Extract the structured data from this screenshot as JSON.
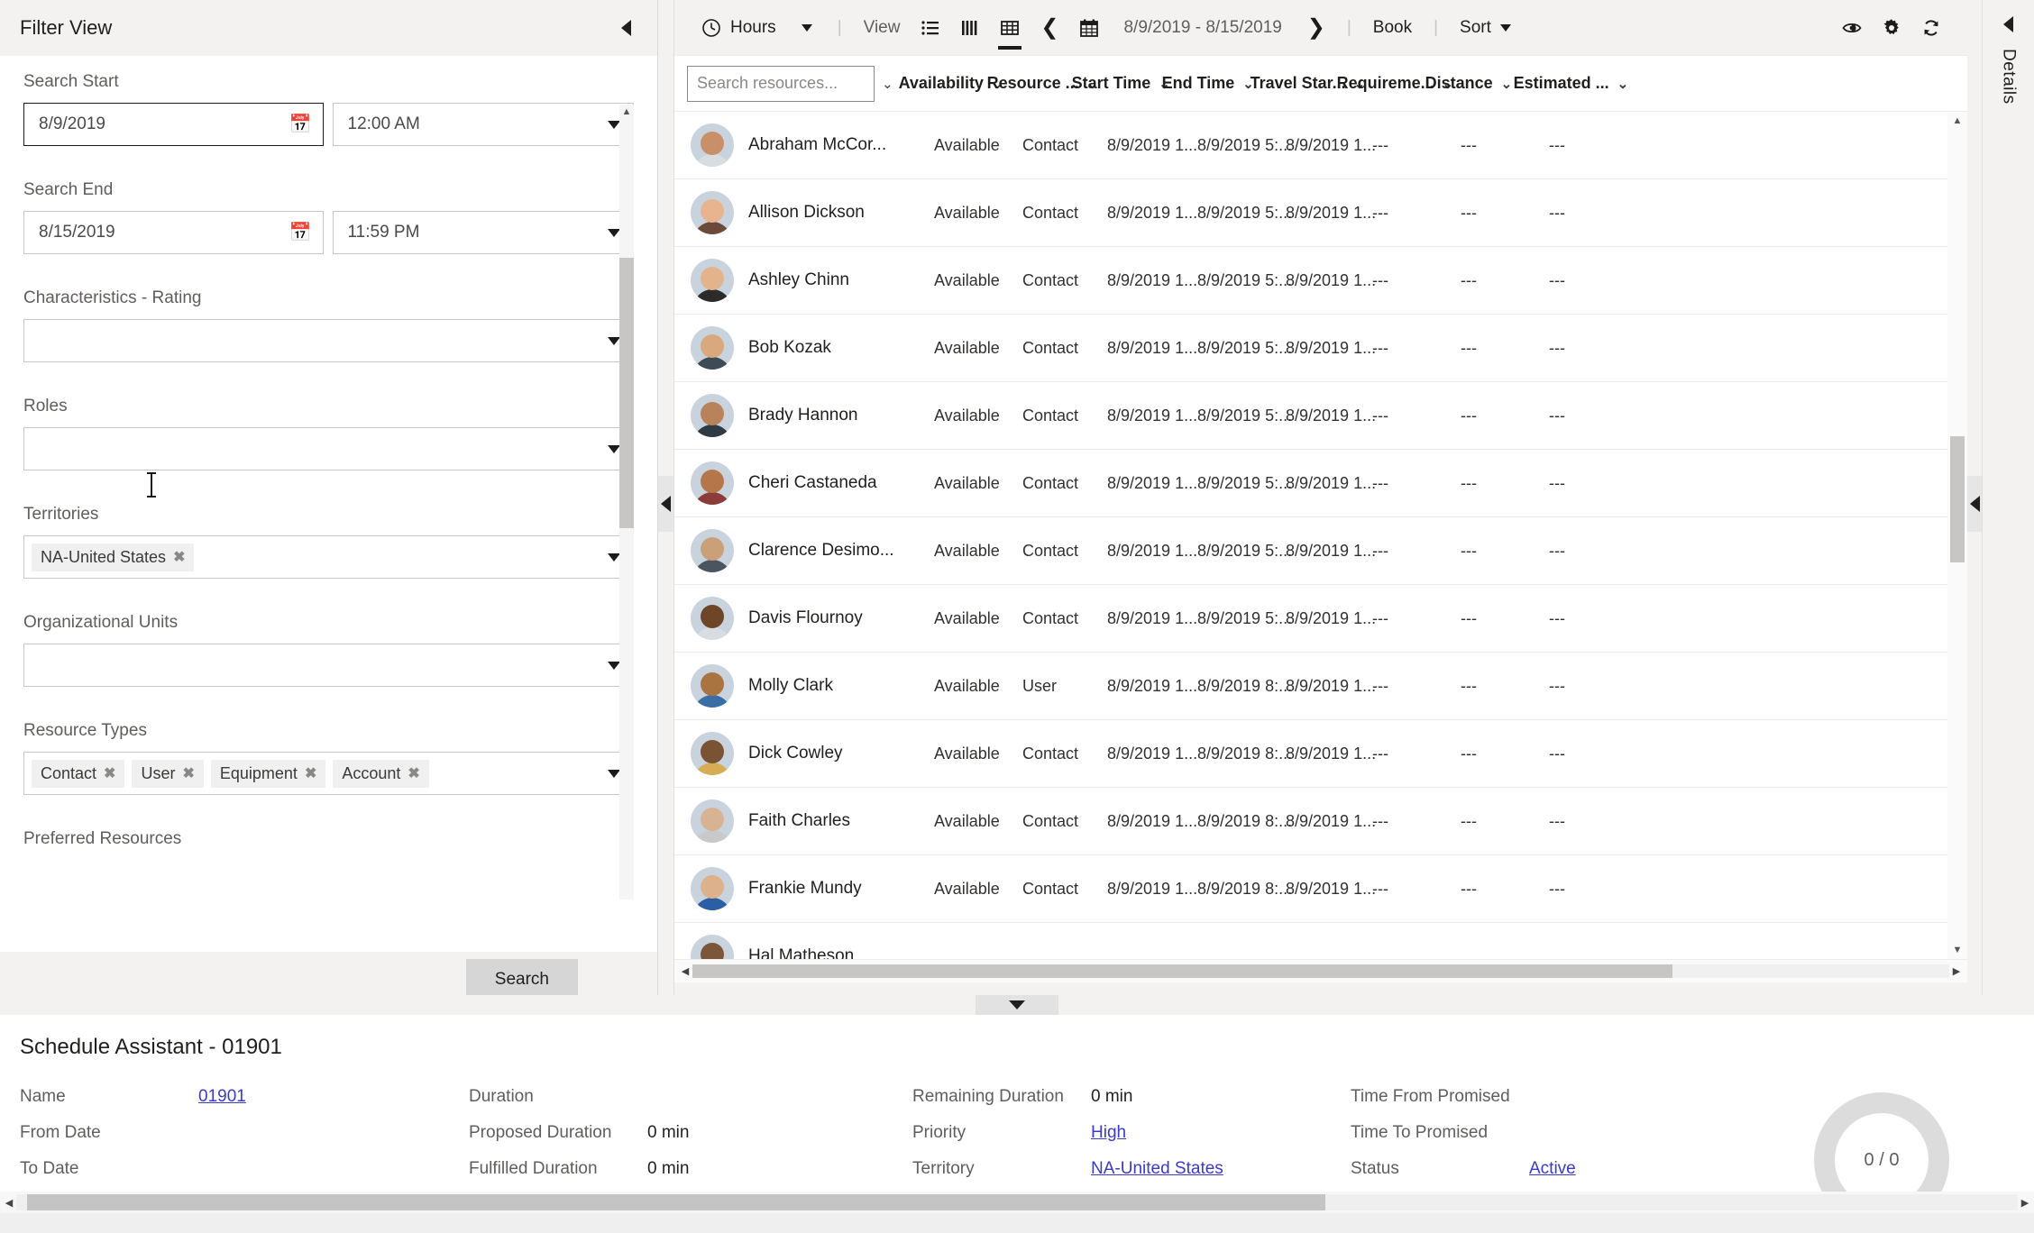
{
  "filter": {
    "title": "Filter View",
    "collapse_icon": "triangle-left-icon",
    "search_start": {
      "label": "Search Start",
      "date_value": "8/9/2019",
      "date_icon": "calendar-icon",
      "time_value": "12:00 AM"
    },
    "search_end": {
      "label": "Search End",
      "date_value": "8/15/2019",
      "date_icon": "calendar-icon",
      "time_value": "11:59 PM"
    },
    "characteristics_rating": {
      "label": "Characteristics - Rating",
      "value": ""
    },
    "roles": {
      "label": "Roles",
      "value": ""
    },
    "territories": {
      "label": "Territories",
      "chips": [
        "NA-United States"
      ]
    },
    "organizational_units": {
      "label": "Organizational Units",
      "value": ""
    },
    "resource_types": {
      "label": "Resource Types",
      "chips": [
        "Contact",
        "User",
        "Equipment",
        "Account"
      ]
    },
    "preferred_resources": {
      "label": "Preferred Resources"
    },
    "search_button": "Search"
  },
  "toolbar": {
    "hours_label": "Hours",
    "hours_icon": "clock-icon",
    "view_label": "View",
    "view_modes": [
      {
        "name": "list-view-icon",
        "selected": false
      },
      {
        "name": "column-view-icon",
        "selected": false
      },
      {
        "name": "grid-view-icon",
        "selected": true
      }
    ],
    "prev_icon": "chevron-left-icon",
    "calendar_icon": "calendar-icon",
    "date_range": "8/9/2019 - 8/15/2019",
    "next_icon": "chevron-right-icon",
    "book_label": "Book",
    "sort_label": "Sort",
    "eye_icon": "eye-icon",
    "gear_icon": "gear-icon",
    "refresh_icon": "refresh-icon"
  },
  "grid": {
    "search_placeholder": "Search resources...",
    "search_value": "",
    "columns": [
      "Availability",
      "Resource ...",
      "Start Time",
      "End Time",
      "Travel Star...",
      "Requireme...",
      "Distance",
      "Estimated ..."
    ],
    "rows": [
      {
        "name": "Abraham McCor...",
        "availability": "Available",
        "type": "Contact",
        "start": "8/9/2019 1...",
        "end": "8/9/2019 5:...",
        "travel": "8/9/2019 1...",
        "requirement": "---",
        "distance": "---",
        "estimated": "---",
        "skin": "#c98f68",
        "shirt": "#d8dde2"
      },
      {
        "name": "Allison Dickson",
        "availability": "Available",
        "type": "Contact",
        "start": "8/9/2019 1...",
        "end": "8/9/2019 5:...",
        "travel": "8/9/2019 1...",
        "requirement": "---",
        "distance": "---",
        "estimated": "---",
        "skin": "#e8b48f",
        "shirt": "#6b4a3a"
      },
      {
        "name": "Ashley Chinn",
        "availability": "Available",
        "type": "Contact",
        "start": "8/9/2019 1...",
        "end": "8/9/2019 5:...",
        "travel": "8/9/2019 1...",
        "requirement": "---",
        "distance": "---",
        "estimated": "---",
        "skin": "#e3b48c",
        "shirt": "#2b2b2b"
      },
      {
        "name": "Bob Kozak",
        "availability": "Available",
        "type": "Contact",
        "start": "8/9/2019 1...",
        "end": "8/9/2019 5:...",
        "travel": "8/9/2019 1...",
        "requirement": "---",
        "distance": "---",
        "estimated": "---",
        "skin": "#d9a87c",
        "shirt": "#3f4a57"
      },
      {
        "name": "Brady Hannon",
        "availability": "Available",
        "type": "Contact",
        "start": "8/9/2019 1...",
        "end": "8/9/2019 5:...",
        "travel": "8/9/2019 1...",
        "requirement": "---",
        "distance": "---",
        "estimated": "---",
        "skin": "#b8835a",
        "shirt": "#2f3a44"
      },
      {
        "name": "Cheri Castaneda",
        "availability": "Available",
        "type": "Contact",
        "start": "8/9/2019 1...",
        "end": "8/9/2019 5:...",
        "travel": "8/9/2019 1...",
        "requirement": "---",
        "distance": "---",
        "estimated": "---",
        "skin": "#b5764a",
        "shirt": "#8c3b3b"
      },
      {
        "name": "Clarence Desimo...",
        "availability": "Available",
        "type": "Contact",
        "start": "8/9/2019 1...",
        "end": "8/9/2019 5:...",
        "travel": "8/9/2019 1...",
        "requirement": "---",
        "distance": "---",
        "estimated": "---",
        "skin": "#caa078",
        "shirt": "#4b5560"
      },
      {
        "name": "Davis Flournoy",
        "availability": "Available",
        "type": "Contact",
        "start": "8/9/2019 1...",
        "end": "8/9/2019 5:...",
        "travel": "8/9/2019 1...",
        "requirement": "---",
        "distance": "---",
        "estimated": "---",
        "skin": "#6e4527",
        "shirt": "#d8dde2"
      },
      {
        "name": "Molly Clark",
        "availability": "Available",
        "type": "User",
        "start": "8/9/2019 1...",
        "end": "8/9/2019 8:...",
        "travel": "8/9/2019 1...",
        "requirement": "---",
        "distance": "---",
        "estimated": "---",
        "skin": "#a9743f",
        "shirt": "#3a6ea5"
      },
      {
        "name": "Dick Cowley",
        "availability": "Available",
        "type": "Contact",
        "start": "8/9/2019 1...",
        "end": "8/9/2019 8:...",
        "travel": "8/9/2019 1...",
        "requirement": "---",
        "distance": "---",
        "estimated": "---",
        "skin": "#7a5234",
        "shirt": "#d6ad55"
      },
      {
        "name": "Faith Charles",
        "availability": "Available",
        "type": "Contact",
        "start": "8/9/2019 1...",
        "end": "8/9/2019 8:...",
        "travel": "8/9/2019 1...",
        "requirement": "---",
        "distance": "---",
        "estimated": "---",
        "skin": "#d7b394",
        "shirt": "#c9c9c9"
      },
      {
        "name": "Frankie Mundy",
        "availability": "Available",
        "type": "Contact",
        "start": "8/9/2019 1...",
        "end": "8/9/2019 8:...",
        "travel": "8/9/2019 1...",
        "requirement": "---",
        "distance": "---",
        "estimated": "---",
        "skin": "#dcb18c",
        "shirt": "#2a5fa5"
      },
      {
        "name": "Hal Matheson",
        "availability": "",
        "type": "",
        "start": "",
        "end": "",
        "travel": "",
        "requirement": "",
        "distance": "",
        "estimated": "",
        "skin": "#7c5638",
        "shirt": "#c4b9a5"
      }
    ]
  },
  "details_rail": {
    "collapse_icon": "triangle-left-icon",
    "label": "Details"
  },
  "bottom": {
    "collapse_icon": "triangle-down-icon",
    "title": "Schedule Assistant - 01901",
    "fields": {
      "col1": [
        {
          "label": "Name",
          "value": "01901",
          "link": true
        },
        {
          "label": "From Date",
          "value": "",
          "link": false
        },
        {
          "label": "To Date",
          "value": "",
          "link": false
        }
      ],
      "col2": [
        {
          "label": "Duration",
          "value": "",
          "link": false
        },
        {
          "label": "Proposed Duration",
          "value": "0 min",
          "link": false
        },
        {
          "label": "Fulfilled Duration",
          "value": "0 min",
          "link": false
        }
      ],
      "col3": [
        {
          "label": "Remaining Duration",
          "value": "0 min",
          "link": false
        },
        {
          "label": "Priority",
          "value": "High",
          "link": true
        },
        {
          "label": "Territory",
          "value": "NA-United States",
          "link": true
        }
      ],
      "col4": [
        {
          "label": "Time From Promised",
          "value": "",
          "link": false
        },
        {
          "label": "Time To Promised",
          "value": "",
          "link": false
        },
        {
          "label": "Status",
          "value": "Active",
          "link": true
        }
      ]
    },
    "progress": "0 / 0"
  }
}
